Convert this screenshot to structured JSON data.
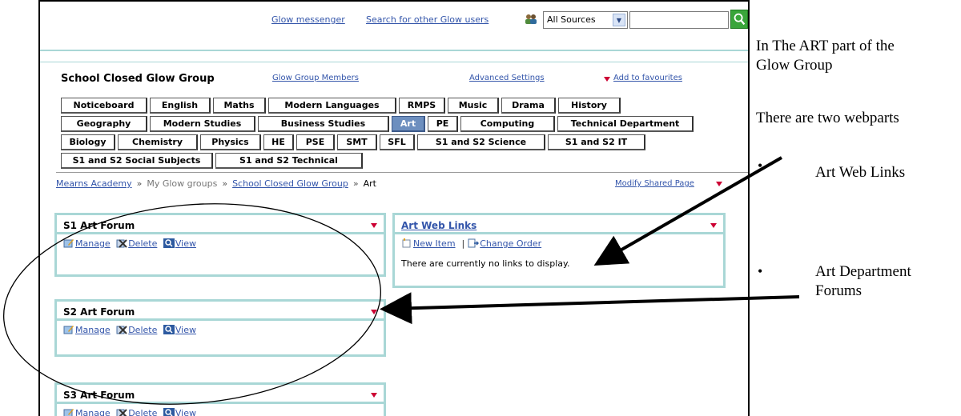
{
  "top": {
    "messenger_link": "Glow messenger",
    "search_users_link": "Search for other Glow users",
    "source_select": "All Sources",
    "search_value": ""
  },
  "header": {
    "group_title": "School Closed Glow Group",
    "members_link": "Glow Group Members",
    "advanced_settings": "Advanced Settings",
    "favourites": "Add to favourites"
  },
  "tabs": {
    "row1": [
      "Noticeboard",
      "English",
      "Maths",
      "Modern Languages",
      "RMPS",
      "Music",
      "Drama",
      "History"
    ],
    "row2": [
      "Geography",
      "Modern Studies",
      "Business Studies",
      "Art",
      "PE",
      "Computing",
      "Technical Department"
    ],
    "row3": [
      "Biology",
      "Chemistry",
      "Physics",
      "HE",
      "PSE",
      "SMT",
      "SFL",
      "S1 and S2 Science",
      "S1 and S2 IT"
    ],
    "row4": [
      "S1 and S2 Social Subjects",
      "S1 and S2 Technical"
    ],
    "active": "Art"
  },
  "breadcrumb": {
    "home": "Mearns Academy",
    "my_groups": "My Glow groups",
    "group": "School Closed Glow Group",
    "current": "Art",
    "separator": "»",
    "modify": "Modify Shared Page"
  },
  "forums": [
    {
      "title": "S1 Art Forum",
      "manage": "Manage",
      "delete": "Delete",
      "view": "View"
    },
    {
      "title": "S2 Art Forum",
      "manage": "Manage",
      "delete": "Delete",
      "view": "View"
    },
    {
      "title": "S3 Art Forum",
      "manage": "Manage",
      "delete": "Delete",
      "view": "View"
    }
  ],
  "web_links": {
    "title": "Art Web Links",
    "new_item": "New Item",
    "separator": "|",
    "change_order": "Change Order",
    "empty_text": "There are currently no links to display."
  },
  "annotations": {
    "intro_line1": "In The ART part of the",
    "intro_line2": "Glow Group",
    "two_webparts": "There are two webparts",
    "item1": "Art Web Links",
    "item2_line1": "Art Department",
    "item2_line2": "Forums",
    "bullet": "•"
  },
  "colors": {
    "link": "#3355aa",
    "webpart_border": "#a9d7d6",
    "active_tab": "#6d8fbf",
    "menu_triangle": "#cc0033",
    "search_go": "#39a53a"
  }
}
